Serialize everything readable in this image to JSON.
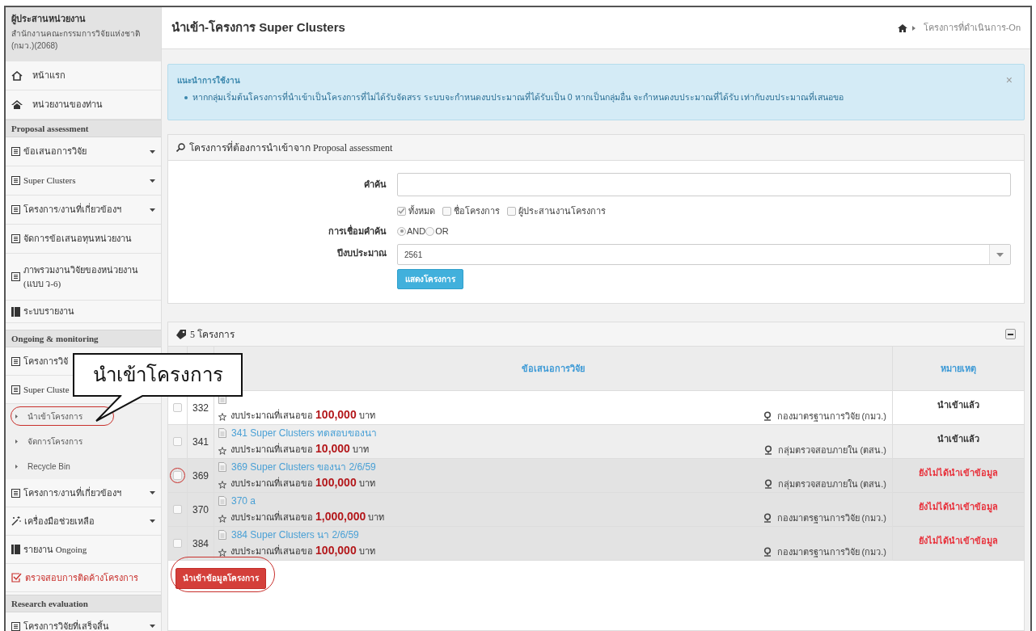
{
  "sidebar": {
    "user_role": "ผู้ประสานหน่วยงาน",
    "organization": "สำนักงานคณะกรรมการวิจัยแห่งชาติ (กมว.)(2068)",
    "items": [
      {
        "kind": "home",
        "label": "หน้าแรก"
      },
      {
        "kind": "office",
        "label": "หน่วยงานของท่าน"
      },
      {
        "kind": "section",
        "label": "Proposal assessment"
      },
      {
        "kind": "page",
        "label": "ข้อเสนอการวิจัย",
        "dropdown": true
      },
      {
        "kind": "page",
        "label": "Super Clusters",
        "dropdown": true
      },
      {
        "kind": "page",
        "label": "โครงการ/งานที่เกี่ยวข้องฯ",
        "dropdown": true
      },
      {
        "kind": "page",
        "label": "จัดการข้อเสนอทุนหน่วยงาน",
        "dropdown": false
      },
      {
        "kind": "page",
        "label": "ภาพรวมงานวิจัยของหน่วยงาน (แบบ ว-6)",
        "dropdown": false
      },
      {
        "kind": "book",
        "label": "ระบบรายงาน"
      },
      {
        "kind": "section",
        "label": "Ongoing & monitoring"
      },
      {
        "kind": "page",
        "label": "โครงการวิจั",
        "dropdown": false
      },
      {
        "kind": "page",
        "label": "Super Cluste",
        "dropdown": false
      },
      {
        "kind": "sub",
        "label": "นำเข้าโครงการ",
        "circled": true
      },
      {
        "kind": "sub",
        "label": "จัดการโครงการ",
        "circled": false
      },
      {
        "kind": "sub",
        "label": "Recycle Bin",
        "circled": false
      },
      {
        "kind": "page",
        "label": "โครงการ/งานที่เกี่ยวข้องฯ",
        "dropdown": true
      },
      {
        "kind": "tools",
        "label": "เครื่องมือช่วยเหลือ",
        "dropdown": true
      },
      {
        "kind": "book",
        "label": "รายงาน Ongoing"
      },
      {
        "kind": "alert",
        "label": "ตรวจสอบการติดค้างโครงการ"
      },
      {
        "kind": "section",
        "label": "Research evaluation"
      },
      {
        "kind": "page",
        "label": "โครงการวิจัยที่เสร็จสิ้น",
        "dropdown": true
      }
    ]
  },
  "page_title": "นำเข้า-โครงการ Super Clusters",
  "breadcrumb": "โครงการที่ดำเนินการ-On",
  "notice": {
    "title": "แนะนำการใช้งาน",
    "close": "×",
    "items": [
      "หากกลุ่มเริ่มต้นโครงการที่นำเข้าเป็นโครงการที่ไม่ได้รับจัดสรร ระบบจะกำหนดงบประมาณที่ได้รับเป็น 0 หากเป็นกลุ่มอื่น จะกำหนดงบประมาณที่ได้รับ เท่ากับงบประมาณที่เสนอขอ"
    ]
  },
  "search_panel": {
    "title": "โครงการที่ต้องการนำเข้าจาก Proposal assessment",
    "keyword_label": "คำค้น",
    "scopes": [
      {
        "label": "ทั้งหมด",
        "checked": true
      },
      {
        "label": "ชื่อโครงการ",
        "checked": false
      },
      {
        "label": "ผู้ประสานงานโครงการ",
        "checked": false
      }
    ],
    "join_label": "การเชื่อมคำค้น",
    "join_options": [
      {
        "label": "AND",
        "selected": true
      },
      {
        "label": "OR",
        "selected": false
      }
    ],
    "year_label": "ปีงบประมาณ",
    "year_value": "2561",
    "submit": "แสดงโครงการ"
  },
  "results": {
    "count": "5 โครงการ",
    "columns": [
      "ข้อเสนอการวิจัย",
      "หมายเหตุ"
    ],
    "rows": [
      {
        "id": "332",
        "budget": "งบประมาณที่เสนอขอ **100,000** บาท",
        "agency": "กองมาตรฐานการวิจัย (กมว.)",
        "note": "นำเข้าแล้ว",
        "imported": true,
        "checked": false,
        "circled": false
      },
      {
        "id": "341",
        "title": "341 Super Clusters ทดสอบของนา",
        "budget": "งบประมาณที่เสนอขอ **10,000** บาท",
        "agency": "กลุ่มตรวจสอบภายใน (ตสน.)",
        "note": "นำเข้าแล้ว",
        "imported": true,
        "checked": false,
        "circled": false
      },
      {
        "id": "369",
        "title": "369 Super Clusters ของนา 2/6/59",
        "budget": "งบประมาณที่เสนอขอ **100,000** บาท",
        "agency": "กลุ่มตรวจสอบภายใน (ตสน.)",
        "note": "ยังไม่ได้นำเข้าข้อมูล",
        "imported": false,
        "checked": false,
        "circled": true
      },
      {
        "id": "370",
        "title": "370 a",
        "budget": "งบประมาณที่เสนอขอ **1,000,000** บาท",
        "agency": "กองมาตรฐานการวิจัย (กมว.)",
        "note": "ยังไม่ได้นำเข้าข้อมูล",
        "imported": false,
        "checked": false,
        "circled": false
      },
      {
        "id": "384",
        "title": "384 Super Clusters นา 2/6/59",
        "budget": "งบประมาณที่เสนอขอ **100,000** บาท",
        "agency": "กองมาตรฐานการวิจัย (กมว.)",
        "note": "ยังไม่ได้นำเข้าข้อมูล",
        "imported": false,
        "checked": false,
        "circled": false
      }
    ],
    "import_button": {
      "label": "นำเข้าข้อมูลโครงการ",
      "circled": true
    }
  },
  "callout": {
    "text": "นำเข้าโครงการ"
  }
}
